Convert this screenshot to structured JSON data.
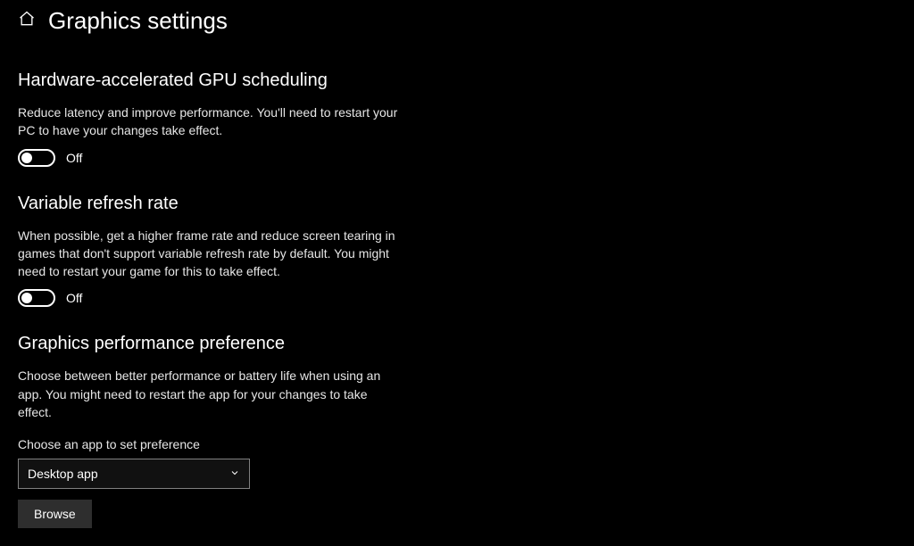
{
  "header": {
    "title": "Graphics settings"
  },
  "sections": {
    "gpu_sched": {
      "heading": "Hardware-accelerated GPU scheduling",
      "desc": "Reduce latency and improve performance. You'll need to restart your PC to have your changes take effect.",
      "toggle_state": "Off"
    },
    "vrr": {
      "heading": "Variable refresh rate",
      "desc": "When possible, get a higher frame rate and reduce screen tearing in games that don't support variable refresh rate by default. You might need to restart your game for this to take effect.",
      "toggle_state": "Off"
    },
    "perf_pref": {
      "heading": "Graphics performance preference",
      "desc": "Choose between better performance or battery life when using an app. You might need to restart the app for your changes to take effect.",
      "choose_label": "Choose an app to set preference",
      "dropdown_selected": "Desktop app",
      "browse_label": "Browse"
    }
  }
}
